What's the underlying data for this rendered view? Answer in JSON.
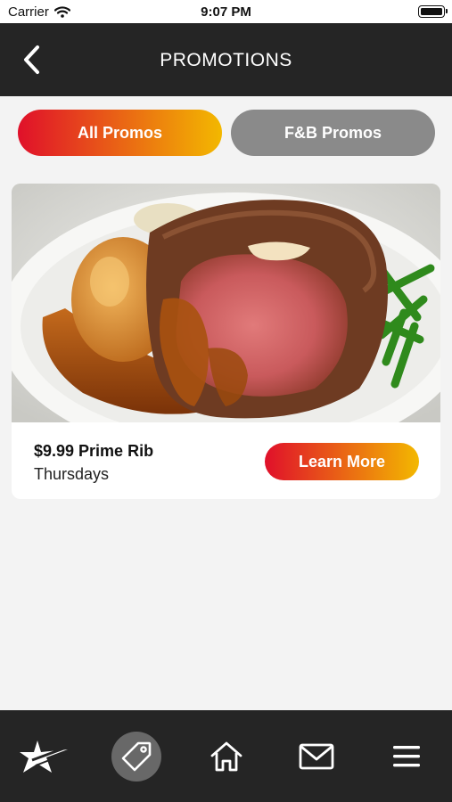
{
  "status_bar": {
    "carrier": "Carrier",
    "time": "9:07 PM",
    "icons": [
      "wifi-icon",
      "battery-icon"
    ]
  },
  "header": {
    "title": "PROMOTIONS",
    "back_icon": "chevron-left-icon"
  },
  "filters": {
    "tabs": [
      {
        "label": "All Promos",
        "selected": true
      },
      {
        "label": "F&B Promos",
        "selected": false
      }
    ]
  },
  "promo": {
    "image": "prime-rib-plate",
    "title": "$9.99 Prime Rib",
    "subtitle": "Thursdays",
    "button_label": "Learn More"
  },
  "bottom_nav": {
    "items": [
      {
        "icon": "star-logo-icon",
        "selected": false
      },
      {
        "icon": "tag-icon",
        "selected": true
      },
      {
        "icon": "home-icon",
        "selected": false
      },
      {
        "icon": "mail-icon",
        "selected": false
      },
      {
        "icon": "menu-icon",
        "selected": false
      }
    ]
  },
  "colors": {
    "gradient_start": "#e0102a",
    "gradient_end": "#f3b800",
    "header_bg": "#252525",
    "inactive_tab": "#8a8a8a",
    "page_bg": "#f3f3f3"
  }
}
